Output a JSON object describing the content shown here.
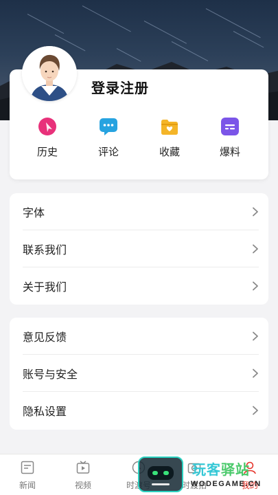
{
  "profile": {
    "username": "登录注册"
  },
  "shortcuts": [
    {
      "label": "历史",
      "icon": "history-icon",
      "color": "#e8317a"
    },
    {
      "label": "评论",
      "icon": "comment-icon",
      "color": "#27a3e0"
    },
    {
      "label": "收藏",
      "icon": "favorites-icon",
      "color": "#f4b528"
    },
    {
      "label": "爆料",
      "icon": "tip-off-icon",
      "color": "#7b55e8"
    }
  ],
  "settings_group_1": [
    {
      "label": "字体"
    },
    {
      "label": "联系我们"
    },
    {
      "label": "关于我们"
    }
  ],
  "settings_group_2": [
    {
      "label": "意见反馈"
    },
    {
      "label": "账号与安全"
    },
    {
      "label": "隐私设置"
    }
  ],
  "tabbar": {
    "items": [
      {
        "label": "新闻",
        "icon": "news-icon"
      },
      {
        "label": "视频",
        "icon": "video-icon"
      },
      {
        "label": "时渡号",
        "icon": "channel-icon"
      },
      {
        "label": "时渡拍",
        "icon": "camera-icon"
      },
      {
        "label": "我的",
        "icon": "profile-icon"
      }
    ],
    "active_index": 4,
    "active_color": "#e5332a"
  },
  "watermark": {
    "title_a": "玩客",
    "title_b": "驿站",
    "domain": "WODEGAME.CN"
  }
}
